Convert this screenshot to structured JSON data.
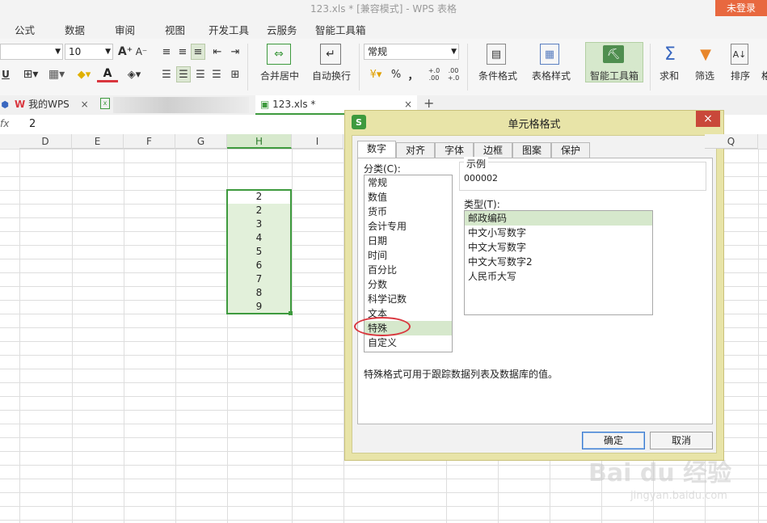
{
  "window": {
    "title": "123.xls * [兼容模式] - WPS 表格",
    "login": "未登录"
  },
  "menu": [
    "公式",
    "数据",
    "审阅",
    "视图",
    "开发工具",
    "云服务",
    "智能工具箱"
  ],
  "ribbon": {
    "font_size": "10",
    "number_format": "常规",
    "merge_center": "合并居中",
    "wrap_text": "自动换行",
    "percent": "%",
    "comma": "，",
    "inc_decimal": "+.0 .00",
    "dec_decimal": ".00 +.0",
    "cond_format": "条件格式",
    "table_style": "表格样式",
    "smart_toolbox": "智能工具箱",
    "sum": "求和",
    "filter": "筛选",
    "sort": "排序"
  },
  "doc_tabs": {
    "my_wps": "我的WPS",
    "file": "123.xls *",
    "add": "+"
  },
  "formula_bar": {
    "fx": "fx",
    "value": "2"
  },
  "columns": [
    "D",
    "E",
    "F",
    "G",
    "H",
    "I",
    "Q"
  ],
  "cells_h": [
    "2",
    "2",
    "3",
    "4",
    "5",
    "6",
    "7",
    "8",
    "9"
  ],
  "dialog": {
    "title": "单元格格式",
    "close": "×",
    "tabs": [
      "数字",
      "对齐",
      "字体",
      "边框",
      "图案",
      "保护"
    ],
    "category_label": "分类(C):",
    "categories": [
      "常规",
      "数值",
      "货币",
      "会计专用",
      "日期",
      "时间",
      "百分比",
      "分数",
      "科学记数",
      "文本",
      "特殊",
      "自定义"
    ],
    "selected_category": "特殊",
    "sample_label": "示例",
    "sample_value": "000002",
    "type_label": "类型(T):",
    "types": [
      "邮政编码",
      "中文小写数字",
      "中文大写数字",
      "中文大写数字2",
      "人民币大写"
    ],
    "selected_type": "邮政编码",
    "description": "特殊格式可用于跟踪数据列表及数据库的值。",
    "ok": "确定",
    "cancel": "取消"
  },
  "watermark": {
    "text": "Bai du 经验",
    "url": "jingyan.baidu.com"
  },
  "colors": {
    "accent_green": "#3e9a3e",
    "selection_fill": "#e2f0da",
    "dialog_frame": "#e8e4a8",
    "highlight_ring": "#d9363e"
  }
}
